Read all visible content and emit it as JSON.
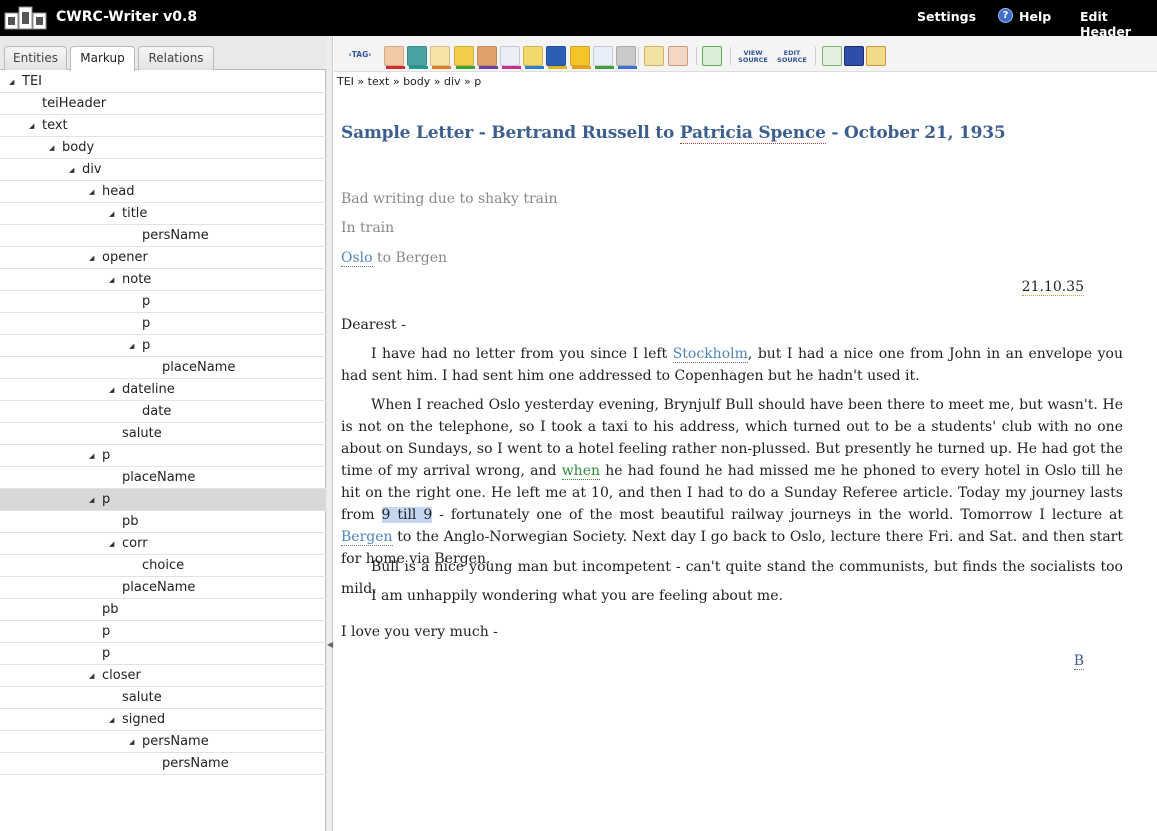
{
  "app": {
    "title": "CWRC-Writer v0.8"
  },
  "header": {
    "settings": "Settings",
    "help": "Help",
    "edit_header": "Edit Header"
  },
  "tabs": [
    "Entities",
    "Markup",
    "Relations"
  ],
  "tree": [
    {
      "label": "TEI",
      "depth": 0,
      "arrow": "down"
    },
    {
      "label": "teiHeader",
      "depth": 1,
      "arrow": ""
    },
    {
      "label": "text",
      "depth": 1,
      "arrow": "down"
    },
    {
      "label": "body",
      "depth": 2,
      "arrow": "down"
    },
    {
      "label": "div",
      "depth": 3,
      "arrow": "down"
    },
    {
      "label": "head",
      "depth": 4,
      "arrow": "down"
    },
    {
      "label": "title",
      "depth": 5,
      "arrow": "down"
    },
    {
      "label": "persName",
      "depth": 6,
      "arrow": ""
    },
    {
      "label": "opener",
      "depth": 4,
      "arrow": "down"
    },
    {
      "label": "note",
      "depth": 5,
      "arrow": "down"
    },
    {
      "label": "p",
      "depth": 6,
      "arrow": ""
    },
    {
      "label": "p",
      "depth": 6,
      "arrow": ""
    },
    {
      "label": "p",
      "depth": 6,
      "arrow": "down"
    },
    {
      "label": "placeName",
      "depth": 7,
      "arrow": ""
    },
    {
      "label": "dateline",
      "depth": 5,
      "arrow": "down"
    },
    {
      "label": "date",
      "depth": 6,
      "arrow": ""
    },
    {
      "label": "salute",
      "depth": 5,
      "arrow": ""
    },
    {
      "label": "p",
      "depth": 4,
      "arrow": "down"
    },
    {
      "label": "placeName",
      "depth": 5,
      "arrow": ""
    },
    {
      "label": "p",
      "depth": 4,
      "arrow": "down",
      "selected": true
    },
    {
      "label": "pb",
      "depth": 5,
      "arrow": ""
    },
    {
      "label": "corr",
      "depth": 5,
      "arrow": "down"
    },
    {
      "label": "choice",
      "depth": 6,
      "arrow": ""
    },
    {
      "label": "placeName",
      "depth": 5,
      "arrow": ""
    },
    {
      "label": "pb",
      "depth": 4,
      "arrow": ""
    },
    {
      "label": "p",
      "depth": 4,
      "arrow": ""
    },
    {
      "label": "p",
      "depth": 4,
      "arrow": ""
    },
    {
      "label": "closer",
      "depth": 4,
      "arrow": "down"
    },
    {
      "label": "salute",
      "depth": 5,
      "arrow": ""
    },
    {
      "label": "signed",
      "depth": 5,
      "arrow": "down"
    },
    {
      "label": "persName",
      "depth": 6,
      "arrow": "down"
    },
    {
      "label": "persName",
      "depth": 7,
      "arrow": ""
    }
  ],
  "toolbar": {
    "tag_label": "‹TAG›",
    "view_source": "VIEW SOURCE",
    "edit_source": "EDIT SOURCE",
    "icons": [
      {
        "name": "person-icon",
        "bar": "#d52b2b"
      },
      {
        "name": "place-icon",
        "bar": "#1c9a8c"
      },
      {
        "name": "date-icon",
        "bar": "#e07b1f"
      },
      {
        "name": "event-icon",
        "bar": "#38a534"
      },
      {
        "name": "organization-icon",
        "bar": "#6a3fb0"
      },
      {
        "name": "citation-icon",
        "bar": "#cc2f8e"
      },
      {
        "name": "note-icon",
        "bar": "#2a7fd0"
      },
      {
        "name": "title-icon",
        "bar": "#e0b41b"
      },
      {
        "name": "correction-icon",
        "bar": "#e6a11a"
      },
      {
        "name": "keyword-icon",
        "bar": "#40a040"
      },
      {
        "name": "link-icon",
        "bar": "#3a6fd8"
      }
    ]
  },
  "breadcrumb": "TEI » text » body » div » p",
  "document": {
    "title_pre": "Sample Letter - Bertrand Russell to ",
    "title_person": "Patricia Spence",
    "title_post": " - October 21, 1935",
    "note1": "Bad writing due to shaky train",
    "note2": "In train",
    "note3_place": "Oslo",
    "note3_rest": " to Bergen",
    "date": "21.10.35",
    "salute": "Dearest -",
    "p1_a": "I have had no letter from you since I left ",
    "p1_place": "Stockholm",
    "p1_b": ", but I had a nice one from John in an envelope you had sent him. I had sent him one addressed to Copenhagen but he hadn't used it.",
    "p2_a": "When I reached Oslo yesterday evening, Brynjulf Bull should have been there to meet me, but wasn't. He is not on the telephone, so I took a taxi to his address, which turned out to be a students' club with no one about on Sundays, so I went to a hotel feeling rather non-plussed. But presently he turned up. He had got the time of my arrival wrong, and ",
    "p2_when": "when",
    "p2_b": " he had found he had missed me he phoned to every hotel in Oslo till he hit on the right one. He left me at 10, and then I had to do a Sunday Referee article. Today my journey lasts from ",
    "p2_hl": "9 till 9",
    "p2_c": " - fortunately one of the most beautiful railway journeys in the world. Tomorrow I lecture at ",
    "p2_place": "Bergen",
    "p2_d": " to the Anglo-Norwegian Society. Next day I go back to Oslo, lecture there Fri. and Sat. and then start for home via Bergen.",
    "p3": "Bull is a nice young man but incompetent - can't quite stand the communists, but finds the socialists too mild.",
    "p4": "I am unhappily wondering what you are feeling about me.",
    "closing": "I love you very much -",
    "signed": "B"
  }
}
